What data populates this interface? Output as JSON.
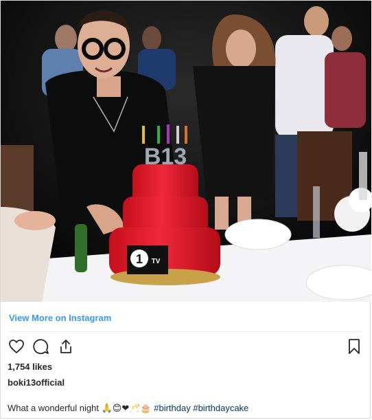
{
  "post": {
    "photo_alt": "Birthday party photo",
    "view_more_label": "View More on Instagram",
    "likes_text": "1,754 likes",
    "username": "boki13official",
    "caption_text": "What a wonderful night",
    "caption_emojis": "🙏😊❤🥂🎂",
    "hashtags": [
      "#birthday",
      "#birthdaycake"
    ],
    "cake_label_number": "1",
    "cake_label_suffix": "TV",
    "cake_topper": "B13"
  },
  "icons": {
    "like": "heart-icon",
    "comment": "comment-icon",
    "share": "share-icon",
    "save": "bookmark-icon"
  },
  "colors": {
    "link": "#3897f0",
    "hashtag": "#003569",
    "text": "#262626",
    "cake": "#e8212e"
  }
}
